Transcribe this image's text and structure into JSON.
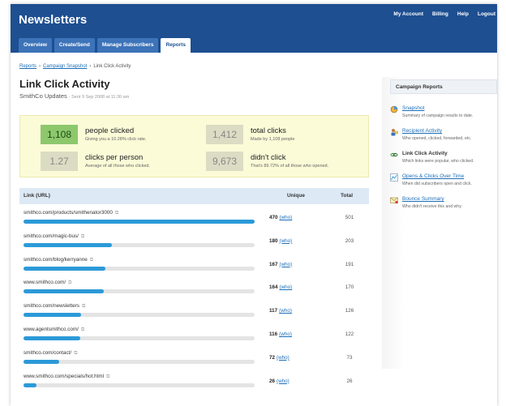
{
  "app": {
    "title": "Newsletters",
    "top_nav": [
      "My Account",
      "Billing",
      "Help",
      "Logout"
    ],
    "tabs": [
      {
        "label": "Overview",
        "active": false
      },
      {
        "label": "Create/Send",
        "active": false
      },
      {
        "label": "Manage Subscribers",
        "active": false
      },
      {
        "label": "Reports",
        "active": true
      }
    ]
  },
  "breadcrumb": {
    "items": [
      "Reports",
      "Campaign Snapshot",
      "Link Click Activity"
    ],
    "separator": "›"
  },
  "page": {
    "title": "Link Click Activity",
    "campaign": "SmithCo Updates",
    "sent": "- Sent 9 Sep 2008 at 11:30 am"
  },
  "stats": [
    {
      "value": "1,108",
      "label": "people clicked",
      "note": "Giving you a 10.28% click rate.",
      "highlight": true
    },
    {
      "value": "1,412",
      "label": "total clicks",
      "note": "Made by 1,108 people",
      "highlight": false
    },
    {
      "value": "1.27",
      "label": "clicks per person",
      "note": "Average of all those who clicked.",
      "highlight": false
    },
    {
      "value": "9,673",
      "label": "didn't click",
      "note": "That's 89.72% of all those who opened.",
      "highlight": false
    }
  ],
  "table": {
    "headers": {
      "url": "Link (URL)",
      "unique": "Unique",
      "total": "Total"
    },
    "who_label": "(who)",
    "rows": [
      {
        "url": "smithco.com/products/smithenator3000",
        "unique": 470,
        "total": 501
      },
      {
        "url": "smithco.com/magic-bus/",
        "unique": 180,
        "total": 203
      },
      {
        "url": "smithco.com/blog/kerryanne",
        "unique": 167,
        "total": 191
      },
      {
        "url": "www.smithco.com/",
        "unique": 164,
        "total": 170
      },
      {
        "url": "smithco.com/newsletters",
        "unique": 117,
        "total": 126
      },
      {
        "url": "www.agentsmithco.com/",
        "unique": 116,
        "total": 122
      },
      {
        "url": "smithco.com/contact/",
        "unique": 72,
        "total": 73
      },
      {
        "url": "www.smithco.com/specials/hot.html",
        "unique": 26,
        "total": 26
      }
    ]
  },
  "sidebar": {
    "title": "Campaign Reports",
    "items": [
      {
        "title": "Snapshot",
        "desc": "Summary of campaign results to date.",
        "link": true,
        "icon": "snapshot-icon"
      },
      {
        "title": "Recipient Activity",
        "desc": "Who opened, clicked, forwarded, etc.",
        "link": true,
        "icon": "recipient-activity-icon"
      },
      {
        "title": "Link Click Activity",
        "desc": "Which links were popular, who clicked.",
        "link": false,
        "icon": "link-click-icon"
      },
      {
        "title": "Opens & Clicks Over Time",
        "desc": "When did subscribers open and click.",
        "link": true,
        "icon": "opens-clicks-chart-icon"
      },
      {
        "title": "Bounce Summary",
        "desc": "Who didn't receive this and why.",
        "link": true,
        "icon": "bounce-mail-icon"
      }
    ]
  },
  "colors": {
    "header": "#1d4f91",
    "tab": "#3d73b8",
    "bar": "#2b9ad8",
    "highlight": "#8dc86d",
    "stats_bg": "#fbfbd8"
  }
}
